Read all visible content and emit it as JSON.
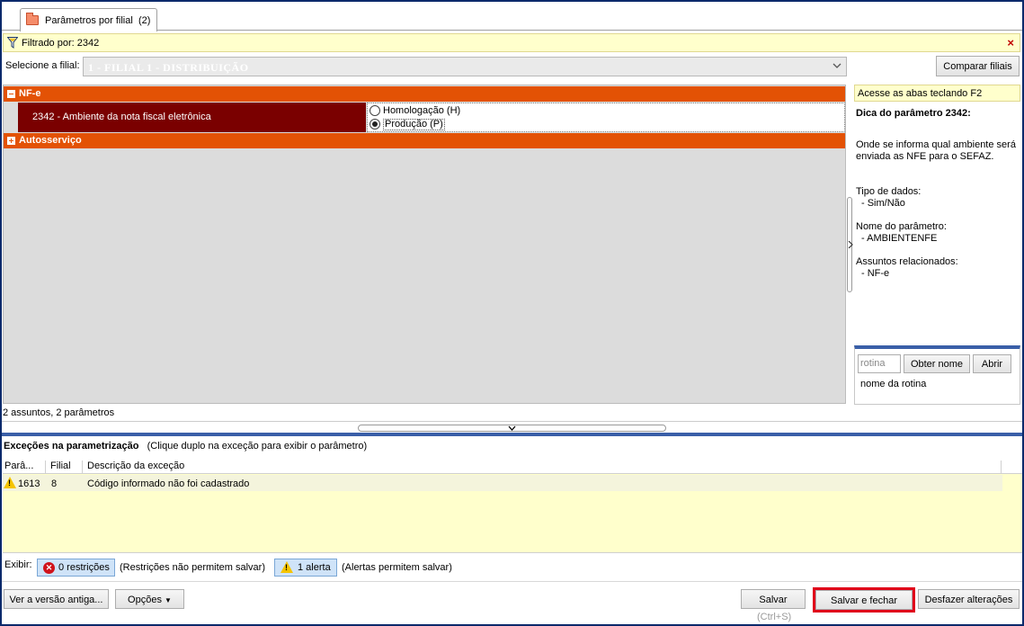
{
  "tab": {
    "title": "Parâmetros por filial",
    "count": "(2)"
  },
  "filter": {
    "text": "Filtrado por: 2342",
    "close": "×"
  },
  "filial": {
    "label": "Selecione a filial:",
    "value": "1 - FILIAL 1 - DISTRIBUIÇÃO",
    "compare_button": "Comparar filiais"
  },
  "groups": [
    {
      "name": "NF-e"
    },
    {
      "name": "Autosserviço"
    }
  ],
  "param": {
    "name": "2342 - Ambiente da nota fiscal eletrônica",
    "options": [
      "Homologação (H)",
      "Produção (P)"
    ],
    "selected_option": "Produção (P)"
  },
  "right_panel": {
    "hint": "Acesse as abas teclando F2",
    "tip_title": "Dica do parâmetro 2342:",
    "description_1": "Onde se informa qual ambiente será",
    "description_2": "enviada as NFE para o SEFAZ.",
    "data_type_label": "Tipo de dados:",
    "data_type_value": "- Sim/Não",
    "param_name_label": "Nome do parâmetro:",
    "param_name_value": "- AMBIENTENFE",
    "subjects_label": "Assuntos relacionados:",
    "subjects_value": "- NF-e",
    "routine_placeholder": "rotina",
    "get_name_button": "Obter nome",
    "open_button": "Abrir",
    "routine_name": "nome da rotina"
  },
  "status": {
    "summary": "2 assuntos, 2 parâmetros"
  },
  "exceptions": {
    "title": "Exceções na parametrização",
    "subtitle": "(Clique duplo na exceção para exibir o parâmetro)",
    "columns": [
      "Parâ...",
      "Filial",
      "Descrição da exceção"
    ],
    "rows": [
      {
        "param": "1613",
        "filial": "8",
        "description": "Código informado não foi cadastrado"
      }
    ]
  },
  "exibir": {
    "label": "Exibir:",
    "restrictions_button": "0 restrições",
    "restrictions_note": "(Restrições não permitem salvar)",
    "alerts_button": "1 alerta",
    "alerts_note": "(Alertas permitem salvar)"
  },
  "footer": {
    "old_version_button": "Ver a versão antiga...",
    "options_button": "Opções",
    "save_button": "Salvar",
    "save_shortcut": "(Ctrl+S)",
    "save_close_button": "Salvar e fechar",
    "undo_button": "Desfazer alterações"
  },
  "colors": {
    "group_header": "#e35205",
    "selected_param": "#7a0000",
    "highlight_box": "#e0001a",
    "accent_bar": "#3a5fa8"
  }
}
